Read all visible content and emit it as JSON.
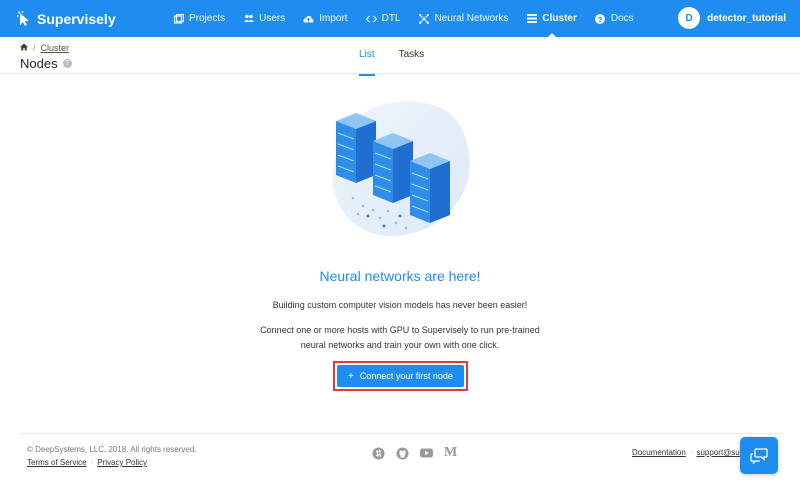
{
  "navbar": {
    "brand": "Supervisely",
    "items": [
      {
        "label": "Projects",
        "icon": "projects-icon",
        "active": false
      },
      {
        "label": "Users",
        "icon": "users-icon",
        "active": false
      },
      {
        "label": "Import",
        "icon": "cloud-upload-icon",
        "active": false
      },
      {
        "label": "DTL",
        "icon": "dtl-arrows-icon",
        "active": false
      },
      {
        "label": "Neural Networks",
        "icon": "neural-network-icon",
        "active": false
      },
      {
        "label": "Cluster",
        "icon": "cluster-list-icon",
        "active": true
      },
      {
        "label": "Docs",
        "icon": "help-circle-icon",
        "active": false
      }
    ],
    "user": {
      "initial": "D",
      "name": "detector_tutorial"
    }
  },
  "subheader": {
    "breadcrumb": {
      "home_icon": "home-icon",
      "link": "Cluster"
    },
    "title": "Nodes",
    "tabs": [
      {
        "label": "List",
        "active": true
      },
      {
        "label": "Tasks",
        "active": false
      }
    ]
  },
  "main": {
    "heading": "Neural networks are here!",
    "description_1": "Building custom computer vision models has never been easier!",
    "description_2": "Connect one or more hosts with GPU to Supervisely to run pre-trained neural networks and train your own with one click.",
    "cta_label": "Connect your first node",
    "illustration": "server-racks-illustration"
  },
  "footer": {
    "copyright": "© DeepSystems, LLC, 2018. All rights reserved.",
    "terms": "Terms of Service",
    "privacy": "Privacy Policy",
    "socials": [
      "slack-icon",
      "github-icon",
      "youtube-icon",
      "medium-icon"
    ],
    "documentation": "Documentation",
    "support": "support@su"
  },
  "colors": {
    "brand": "#1f8df0",
    "highlight": "#e03a3a"
  }
}
